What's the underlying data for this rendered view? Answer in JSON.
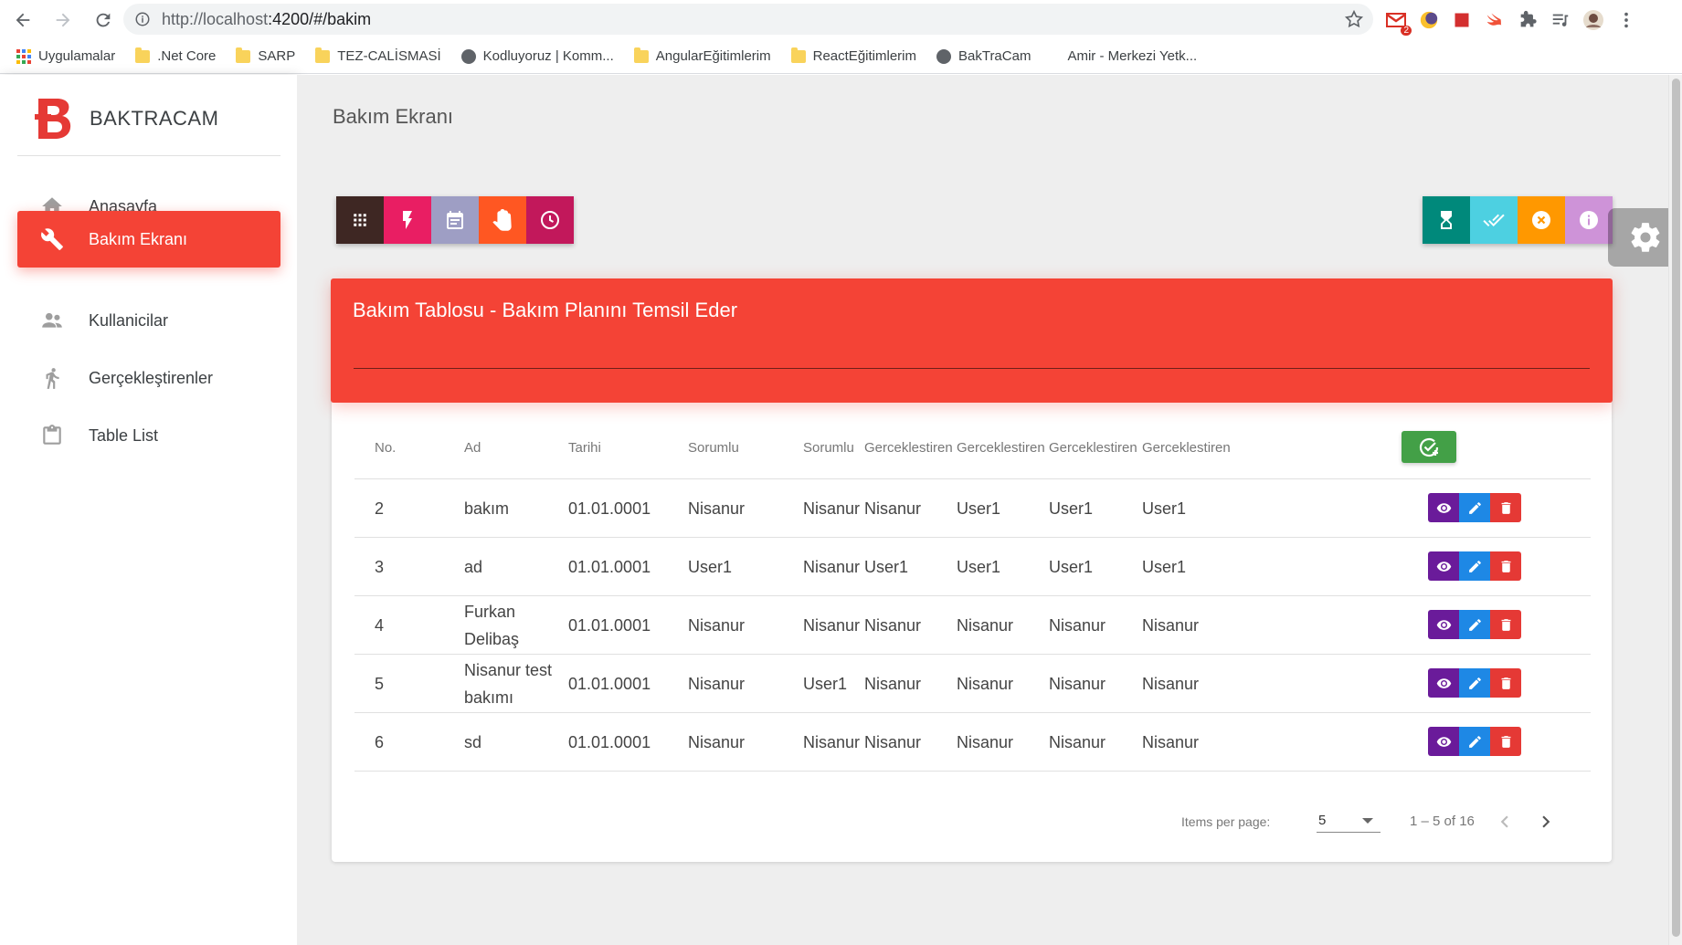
{
  "browser": {
    "url_host": "http://localhost",
    "url_path": ":4200/#/bakim",
    "gmail_badge": "2",
    "bookmarks": [
      {
        "label": "Uygulamalar",
        "icon": "apps-grid-icon"
      },
      {
        "label": ".Net Core",
        "icon": "folder-icon"
      },
      {
        "label": "SARP",
        "icon": "folder-icon"
      },
      {
        "label": "TEZ-CALİSMASİ",
        "icon": "folder-icon"
      },
      {
        "label": "Kodluyoruz | Komm...",
        "icon": "globe-icon"
      },
      {
        "label": "AngularEğitimlerim",
        "icon": "folder-icon"
      },
      {
        "label": "ReactEğitimlerim",
        "icon": "folder-icon"
      },
      {
        "label": "BakTraCam",
        "icon": "globe-icon"
      },
      {
        "label": "Amir - Merkezi Yetk...",
        "icon": "none"
      }
    ]
  },
  "sidebar": {
    "brand": "BAKTRACAM",
    "items": [
      {
        "label": "Anasayfa",
        "icon": "home-icon",
        "active": false
      },
      {
        "label": "Bakım Ekranı",
        "icon": "wrench-icon",
        "active": true
      },
      {
        "label": "Kullanicilar",
        "icon": "people-icon",
        "active": false
      },
      {
        "label": "Gerçekleştirenler",
        "icon": "runner-icon",
        "active": false
      },
      {
        "label": "Table List",
        "icon": "clipboard-icon",
        "active": false
      }
    ]
  },
  "main": {
    "page_title": "Bakım Ekranı",
    "left_buttons": [
      {
        "icon": "apps-icon",
        "color": "#3e2723"
      },
      {
        "icon": "flash-icon",
        "color": "#e91e63"
      },
      {
        "icon": "calendar-icon",
        "color": "#9e9ec4"
      },
      {
        "icon": "hand-icon",
        "color": "#ff5722"
      },
      {
        "icon": "clock-icon",
        "color": "#c2185b"
      }
    ],
    "right_buttons": [
      {
        "icon": "hourglass-icon",
        "color": "#00897b"
      },
      {
        "icon": "double-check-icon",
        "color": "#4dd0e1"
      },
      {
        "icon": "cancel-icon",
        "color": "#ff9800"
      },
      {
        "icon": "info-icon",
        "color": "#ce93d8"
      }
    ],
    "card": {
      "title": "Bakım Tablosu - Bakım Planını Temsil Eder",
      "accent": "#f44336",
      "columns": [
        "No.",
        "Ad",
        "Tarihi",
        "Sorumlu",
        "Sorumlu",
        "Gerceklestiren",
        "Gerceklestiren",
        "Gerceklestiren",
        "Gerceklestiren"
      ],
      "rows": [
        [
          "2",
          "bakım",
          "01.01.0001",
          "Nisanur",
          "Nisanur",
          "Nisanur",
          "User1",
          "User1",
          "User1"
        ],
        [
          "3",
          "ad",
          "01.01.0001",
          "User1",
          "Nisanur",
          "User1",
          "User1",
          "User1",
          "User1"
        ],
        [
          "4",
          "Furkan Delibaş",
          "01.01.0001",
          "Nisanur",
          "Nisanur",
          "Nisanur",
          "Nisanur",
          "Nisanur",
          "Nisanur"
        ],
        [
          "5",
          "Nisanur test bakımı",
          "01.01.0001",
          "Nisanur",
          "User1",
          "Nisanur",
          "Nisanur",
          "Nisanur",
          "Nisanur"
        ],
        [
          "6",
          "sd",
          "01.01.0001",
          "Nisanur",
          "Nisanur",
          "Nisanur",
          "Nisanur",
          "Nisanur",
          "Nisanur"
        ]
      ],
      "paginator": {
        "items_per_page_label": "Items per page:",
        "items_per_page_value": "5",
        "range": "1 – 5 of 16"
      }
    }
  }
}
